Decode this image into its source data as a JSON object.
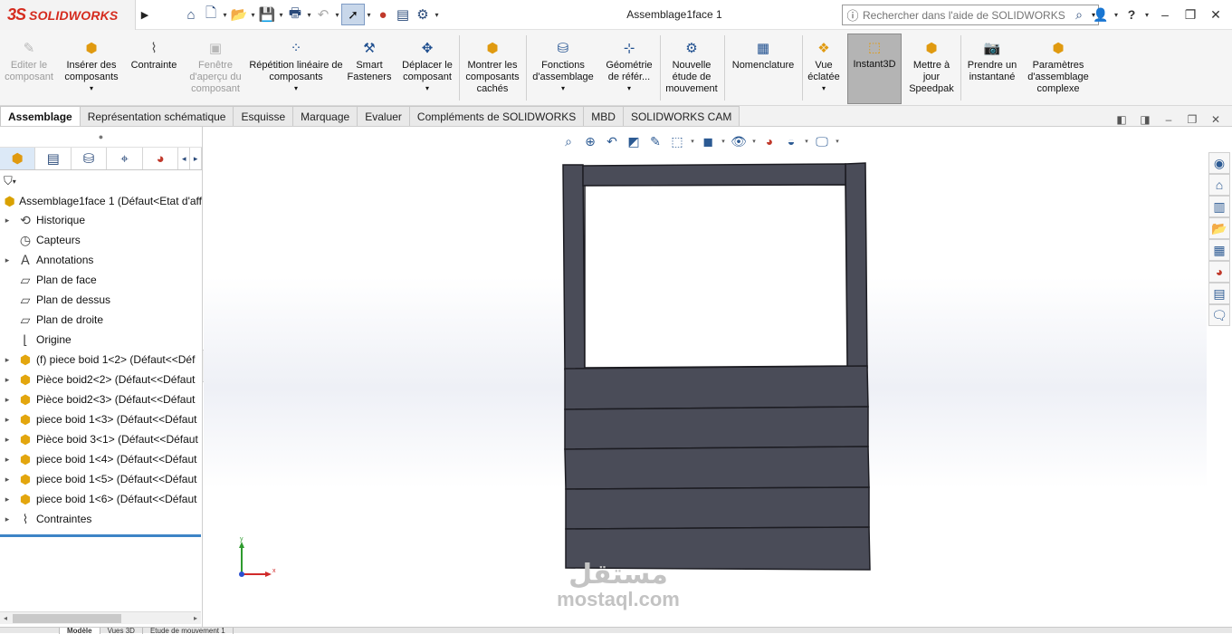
{
  "app": {
    "brand": "SOLIDWORKS",
    "brand_mark": "3S",
    "doc_title": "Assemblage1face 1"
  },
  "search": {
    "placeholder": "Rechercher dans l'aide de SOLIDWORKS"
  },
  "commands": [
    {
      "label": "Editer le composant",
      "icon": "edit-component-icon",
      "enabled": false
    },
    {
      "label": "Insérer des composants",
      "icon": "insert-components-icon",
      "enabled": true,
      "dropdown": true
    },
    {
      "label": "Contrainte",
      "icon": "mate-icon",
      "enabled": true
    },
    {
      "label": "Fenêtre d'aperçu du composant",
      "icon": "preview-window-icon",
      "enabled": false
    },
    {
      "label": "Répétition linéaire de composants",
      "icon": "linear-pattern-icon",
      "enabled": true,
      "dropdown": true
    },
    {
      "label": "Smart Fasteners",
      "icon": "smart-fasteners-icon",
      "enabled": true
    },
    {
      "label": "Déplacer le composant",
      "icon": "move-component-icon",
      "enabled": true,
      "dropdown": true
    },
    {
      "label": "Montrer les composants cachés",
      "icon": "show-hidden-icon",
      "enabled": true
    },
    {
      "label": "Fonctions d'assemblage",
      "icon": "assembly-features-icon",
      "enabled": true,
      "dropdown": true
    },
    {
      "label": "Géométrie de référ...",
      "icon": "reference-geometry-icon",
      "enabled": true,
      "dropdown": true
    },
    {
      "label": "Nouvelle étude de mouvement",
      "icon": "motion-study-icon",
      "enabled": true
    },
    {
      "label": "Nomenclature",
      "icon": "bom-icon",
      "enabled": true
    },
    {
      "label": "Vue éclatée",
      "icon": "exploded-view-icon",
      "enabled": true,
      "dropdown": true
    },
    {
      "label": "Instant3D",
      "icon": "instant3d-icon",
      "enabled": true,
      "active": true
    },
    {
      "label": "Mettre à jour Speedpak",
      "icon": "speedpak-icon",
      "enabled": true
    },
    {
      "label": "Prendre un instantané",
      "icon": "snapshot-icon",
      "enabled": true
    },
    {
      "label": "Paramètres d'assemblage complexe",
      "icon": "large-assembly-icon",
      "enabled": true
    }
  ],
  "tabs": [
    {
      "label": "Assemblage",
      "active": true
    },
    {
      "label": "Représentation schématique"
    },
    {
      "label": "Esquisse"
    },
    {
      "label": "Marquage"
    },
    {
      "label": "Evaluer"
    },
    {
      "label": "Compléments de SOLIDWORKS"
    },
    {
      "label": "MBD"
    },
    {
      "label": "SOLIDWORKS CAM"
    }
  ],
  "tree": {
    "root": "Assemblage1face 1  (Défaut<Etat d'aff",
    "nodes": [
      {
        "label": "Historique",
        "icon": "history-icon",
        "expandable": true
      },
      {
        "label": "Capteurs",
        "icon": "sensors-icon",
        "expandable": false
      },
      {
        "label": "Annotations",
        "icon": "annotations-icon",
        "expandable": true
      },
      {
        "label": "Plan de face",
        "icon": "plane-icon",
        "expandable": false
      },
      {
        "label": "Plan de dessus",
        "icon": "plane-icon",
        "expandable": false
      },
      {
        "label": "Plan de droite",
        "icon": "plane-icon",
        "expandable": false
      },
      {
        "label": "Origine",
        "icon": "origin-icon",
        "expandable": false
      },
      {
        "label": "(f) piece boid 1<2>  (Défaut<<Déf",
        "icon": "part-icon",
        "expandable": true
      },
      {
        "label": "Pièce boid2<2>  (Défaut<<Défaut",
        "icon": "part-icon",
        "expandable": true
      },
      {
        "label": "Pièce boid2<3>  (Défaut<<Défaut",
        "icon": "part-icon",
        "expandable": true
      },
      {
        "label": "piece boid 1<3>  (Défaut<<Défaut",
        "icon": "part-icon",
        "expandable": true
      },
      {
        "label": "Pièce boid 3<1>  (Défaut<<Défaut",
        "icon": "part-icon",
        "expandable": true
      },
      {
        "label": "piece boid 1<4>  (Défaut<<Défaut",
        "icon": "part-icon",
        "expandable": true
      },
      {
        "label": "piece boid 1<5>  (Défaut<<Défaut",
        "icon": "part-icon",
        "expandable": true
      },
      {
        "label": "piece boid 1<6>  (Défaut<<Défaut",
        "icon": "part-icon",
        "expandable": true
      },
      {
        "label": "Contraintes",
        "icon": "mates-folder-icon",
        "expandable": true
      }
    ]
  },
  "triad": {
    "x": "x",
    "y": "y"
  },
  "bottom_tabs": [
    {
      "label": "Modèle",
      "active": true
    },
    {
      "label": "Vues 3D"
    },
    {
      "label": "Etude de mouvement 1"
    }
  ],
  "watermark": {
    "arabic": "مستقل",
    "latin": "mostaql.com"
  },
  "colors": {
    "brand": "#d52b1e",
    "model_fill": "#4a4c58",
    "selection_accent": "#3d84c6"
  }
}
